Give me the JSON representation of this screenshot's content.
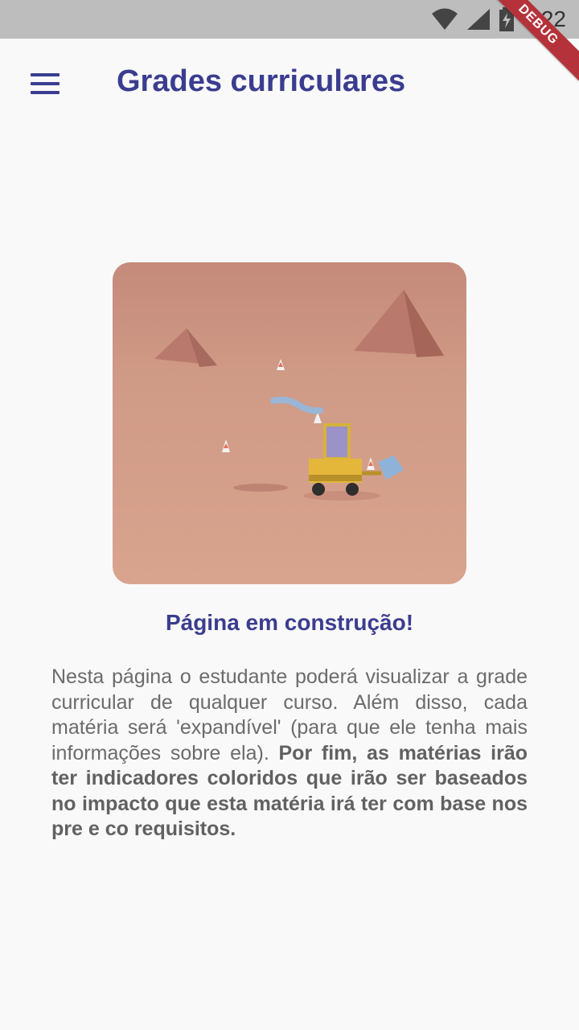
{
  "status_bar": {
    "time": "5:22",
    "icons": [
      "wifi-icon",
      "cell-signal-icon",
      "battery-charging-icon"
    ],
    "debug_label": "DEBUG"
  },
  "app_bar": {
    "title": "Grades curriculares",
    "menu_icon": "hamburger-menu-icon"
  },
  "illustration": {
    "subject": "construction-bulldozer-illustration"
  },
  "content": {
    "heading": "Página em construção!",
    "description_regular": "Nesta página o estudante poderá visualizar a grade curricular de qualquer curso. Além disso, cada matéria será 'expandível' (para que ele tenha mais informações sobre ela).",
    "description_bold": "Por fim, as matérias irão ter indicadores coloridos que irão ser baseados no impacto que esta matéria irá ter com base nos pre e co requisitos."
  },
  "colors": {
    "primary": "#3a3d8f",
    "background": "#f9f9f9",
    "status_bar": "#bdbdbd",
    "text": "#6b6b6b",
    "debug_banner": "#b5323a"
  }
}
